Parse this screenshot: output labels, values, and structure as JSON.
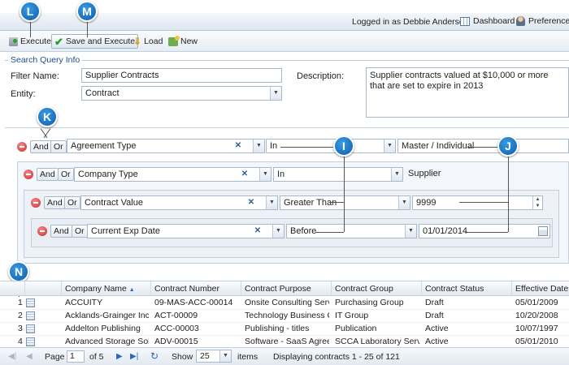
{
  "header": {
    "user_text": "Logged in as Debbie Anderson",
    "dashboard_label": "Dashboard",
    "preferences_label": "Preferences"
  },
  "toolbar": {
    "execute_label": "Execute",
    "save_execute_label": "Save and Execute",
    "load_label": "Load",
    "new_label": "New"
  },
  "query_info": {
    "legend": "Search Query Info",
    "filter_name_label": "Filter Name:",
    "filter_name_value": "Supplier Contracts",
    "entity_label": "Entity:",
    "entity_value": "Contract",
    "description_label": "Description:",
    "description_value": "Supplier contracts valued at $10,000 or more that are set to expire in 2013"
  },
  "conditions": [
    {
      "and": "And",
      "or": "Or",
      "field": "Agreement Type",
      "operator": "In",
      "value": "Master / Individual"
    },
    {
      "and": "And",
      "or": "Or",
      "field": "Company Type",
      "operator": "In",
      "value": "Supplier"
    },
    {
      "and": "And",
      "or": "Or",
      "field": "Contract Value",
      "operator": "Greater Than",
      "value": "9999"
    },
    {
      "and": "And",
      "or": "Or",
      "field": "Current Exp Date",
      "operator": "Before",
      "value": "01/01/2014"
    }
  ],
  "callouts": {
    "l": "L",
    "m": "M",
    "k": "K",
    "i": "I",
    "j": "J",
    "n": "N"
  },
  "grid": {
    "columns": [
      "Company Name",
      "Contract Number",
      "Contract Purpose",
      "Contract Group",
      "Contract Status",
      "Effective Date"
    ],
    "sort_indicator": "▲",
    "rows": [
      {
        "num": "1",
        "company": "ACCUITY",
        "number": "09-MAS-ACC-00014",
        "purpose": "Onsite Consulting Servi...",
        "group": "Purchasing Group",
        "status": "Draft",
        "date": "05/01/2009"
      },
      {
        "num": "2",
        "company": "Acklands-Grainger Inc.",
        "number": "ACT-00009",
        "purpose": "Technology Business C...",
        "group": "IT Group",
        "status": "Draft",
        "date": "10/20/2008"
      },
      {
        "num": "3",
        "company": "Addelton Publishing",
        "number": "ACC-00003",
        "purpose": "Publishing - titles",
        "group": "Publication",
        "status": "Active",
        "date": "10/07/1997"
      },
      {
        "num": "4",
        "company": "Advanced Storage Solu...",
        "number": "ADV-00015",
        "purpose": "Software - SaaS Agree...",
        "group": "SCCA Laboratory Servic...",
        "status": "Active",
        "date": "05/01/2010"
      }
    ]
  },
  "pager": {
    "page_label": "Page",
    "page_value": "1",
    "of_text": "of 5",
    "show_label": "Show",
    "show_value": "25",
    "items_label": "items",
    "display_text": "Displaying contracts 1 - 25 of 121"
  }
}
